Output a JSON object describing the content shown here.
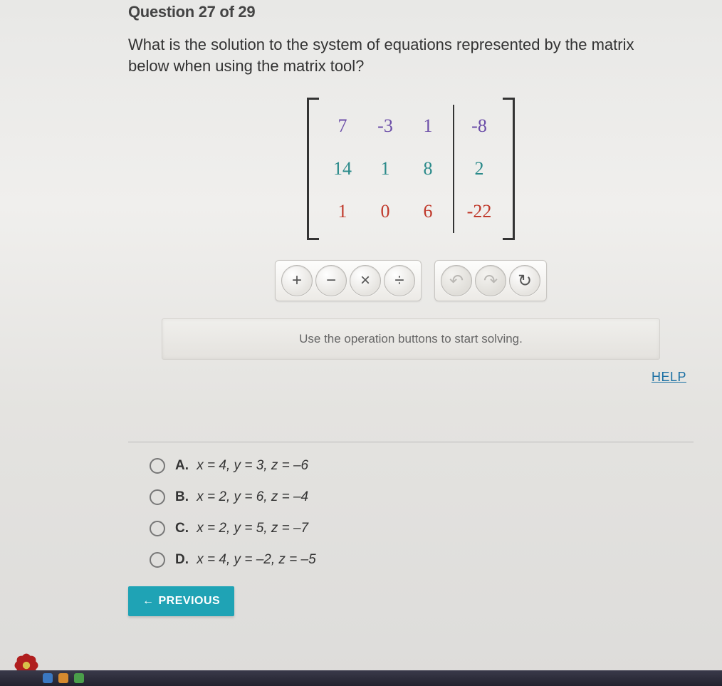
{
  "header": "Question 27 of 29",
  "question": "What is the solution to the system of equations represented by the matrix below when using the matrix tool?",
  "chart_data": {
    "type": "table",
    "title": "Augmented matrix",
    "rows": [
      [
        7,
        -3,
        1,
        -8
      ],
      [
        14,
        1,
        8,
        2
      ],
      [
        1,
        0,
        6,
        -22
      ]
    ]
  },
  "matrix": {
    "r1": {
      "a": "7",
      "b": "-3",
      "c": "1",
      "d": "-8"
    },
    "r2": {
      "a": "14",
      "b": "1",
      "c": "8",
      "d": "2"
    },
    "r3": {
      "a": "1",
      "b": "0",
      "c": "6",
      "d": "-22"
    }
  },
  "ops": {
    "plus": "+",
    "minus": "−",
    "times": "×",
    "divide": "÷",
    "undo": "↶",
    "redo": "↷",
    "reset": "↻"
  },
  "instruction": "Use the operation buttons to start solving.",
  "help": "HELP",
  "answers": {
    "a": {
      "label": "A.",
      "text": "x = 4, y = 3, z = –6"
    },
    "b": {
      "label": "B.",
      "text": "x = 2, y = 6, z = –4"
    },
    "c": {
      "label": "C.",
      "text": "x = 2, y = 5, z = –7"
    },
    "d": {
      "label": "D.",
      "text": "x = 4, y = –2, z = –5"
    }
  },
  "nav": {
    "previous": "PREVIOUS"
  }
}
